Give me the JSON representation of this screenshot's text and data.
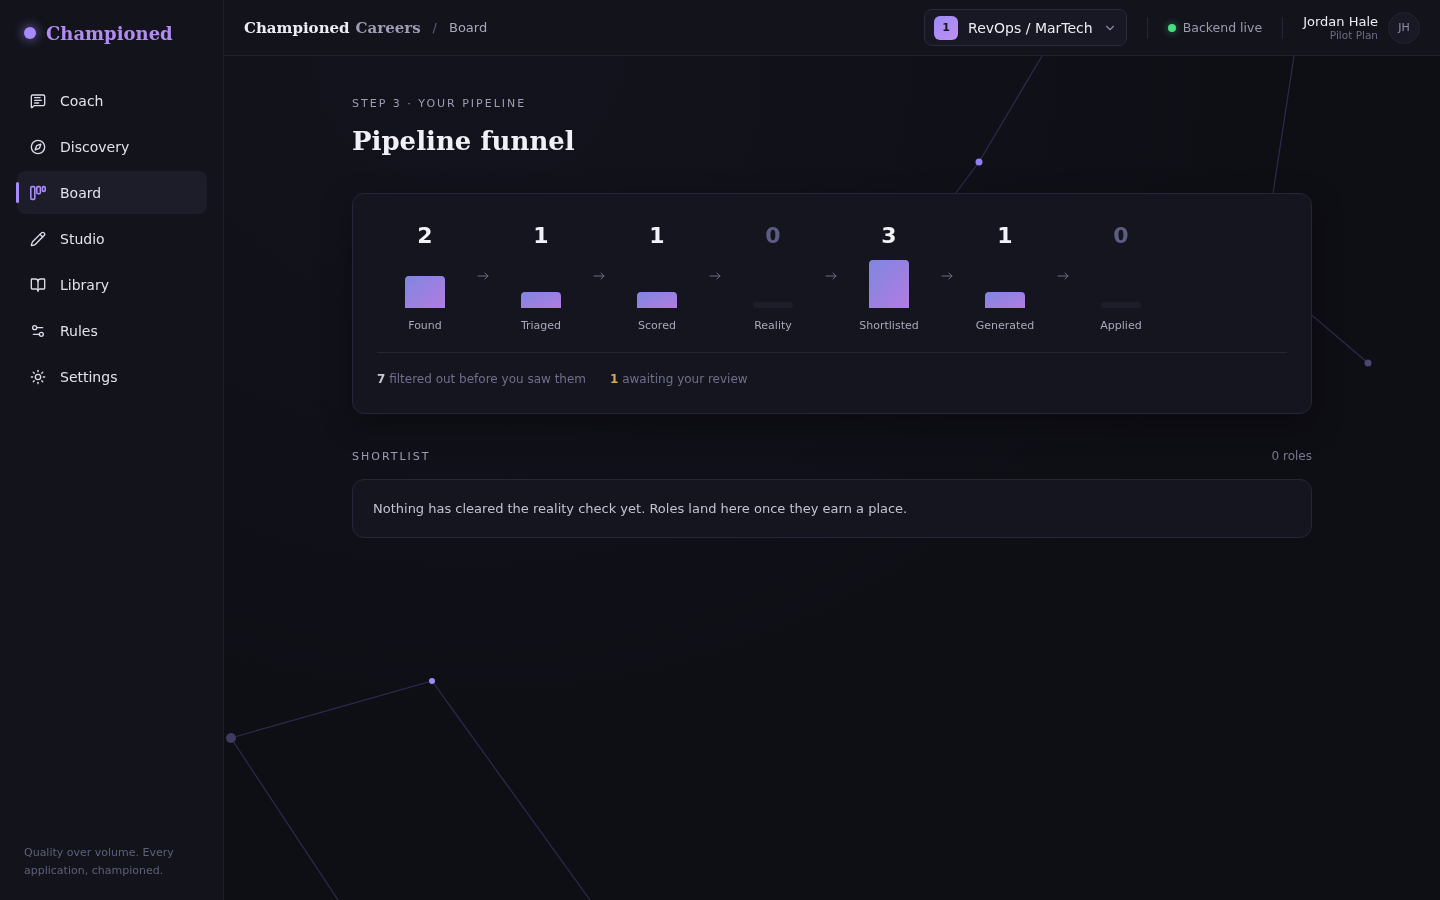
{
  "sidebar": {
    "logo": "Championed",
    "nav": [
      {
        "label": "Coach",
        "selected": false
      },
      {
        "label": "Discovery",
        "selected": false
      },
      {
        "label": "Board",
        "selected": true
      },
      {
        "label": "Studio",
        "selected": false
      },
      {
        "label": "Library",
        "selected": false
      },
      {
        "label": "Rules",
        "selected": false
      },
      {
        "label": "Settings",
        "selected": false
      }
    ],
    "tagline": "Quality over volume. Every application, championed."
  },
  "topbar": {
    "title": {
      "brand": "Championed",
      "product": "Careers"
    },
    "separator": "/",
    "breadcrumb": "Board",
    "workspace": {
      "number": "1",
      "name": "RevOps / MarTech"
    },
    "status": {
      "label": "Backend live",
      "online": true
    },
    "user": {
      "name": "Jordan Hale",
      "plan": "Pilot Plan",
      "initials": "JH"
    }
  },
  "page": {
    "eyebrow": "STEP 3 · YOUR PIPELINE",
    "title": "Pipeline funnel"
  },
  "funnel": {
    "chart_data": {
      "type": "bar",
      "categories": [
        "Found",
        "Triaged",
        "Scored",
        "Reality",
        "Shortlisted",
        "Generated",
        "Applied"
      ],
      "values": [
        2,
        1,
        1,
        0,
        3,
        1,
        0
      ],
      "data_labels": true
    },
    "summary": [
      {
        "kind": "filtered",
        "text": "**7** filtered out before you saw them"
      },
      {
        "kind": "pending",
        "text": "**1** awaiting your review"
      }
    ]
  },
  "shortlist": {
    "heading": "SHORTLIST",
    "count": "0 roles",
    "empty_message": "Nothing has cleared the reality check yet. Roles land here once they earn a place."
  }
}
